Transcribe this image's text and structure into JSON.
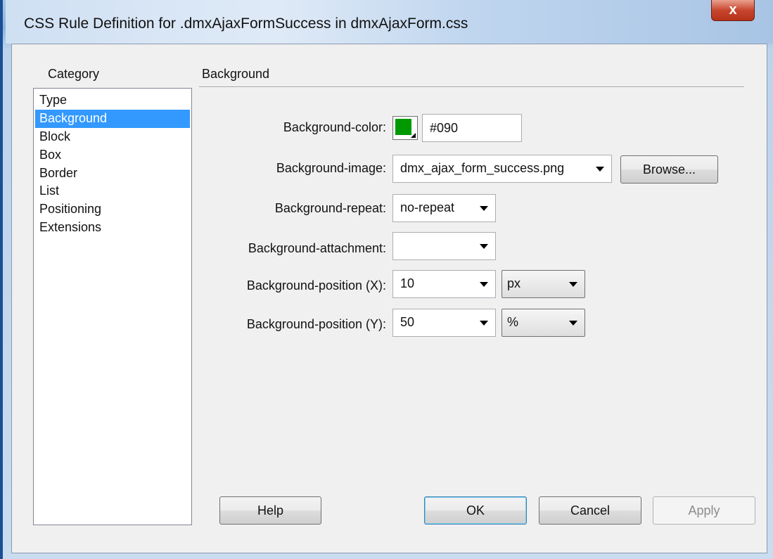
{
  "window": {
    "title": "CSS Rule Definition for .dmxAjaxFormSuccess in dmxAjaxForm.css",
    "close_label": "x"
  },
  "category": {
    "label": "Category",
    "items": [
      "Type",
      "Background",
      "Block",
      "Box",
      "Border",
      "List",
      "Positioning",
      "Extensions"
    ],
    "selected": "Background"
  },
  "section": {
    "title": "Background"
  },
  "fields": {
    "color": {
      "label": "Background-color:",
      "value": "#090",
      "swatch_color": "#009900"
    },
    "image": {
      "label": "Background-image:",
      "value": "dmx_ajax_form_success.png",
      "browse_label": "Browse..."
    },
    "repeat": {
      "label": "Background-repeat:",
      "value": "no-repeat"
    },
    "attachment": {
      "label": "Background-attachment:",
      "value": ""
    },
    "pos_x": {
      "label": "Background-position (X):",
      "value": "10",
      "unit": "px"
    },
    "pos_y": {
      "label": "Background-position (Y):",
      "value": "50",
      "unit": "%"
    }
  },
  "buttons": {
    "help": "Help",
    "ok": "OK",
    "cancel": "Cancel",
    "apply": "Apply"
  }
}
